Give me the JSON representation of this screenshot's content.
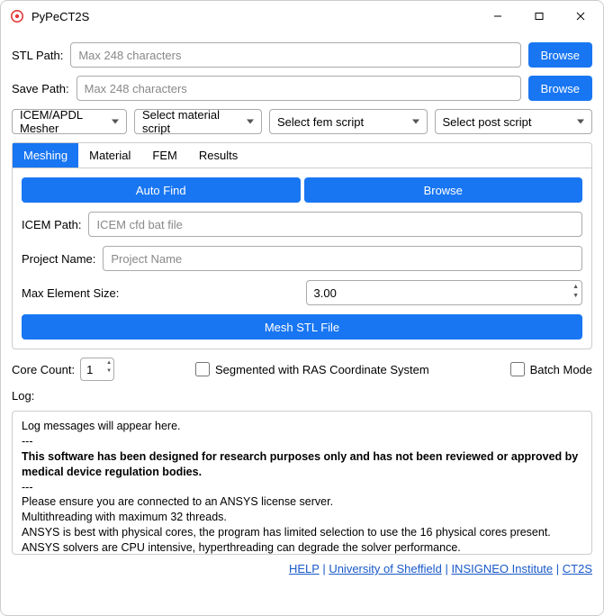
{
  "title": "PyPeCT2S",
  "stl": {
    "label": "STL Path:",
    "placeholder": "Max 248 characters",
    "browse": "Browse"
  },
  "save": {
    "label": "Save Path:",
    "placeholder": "Max 248 characters",
    "browse": "Browse"
  },
  "selects": {
    "mesher": "ICEM/APDL Mesher",
    "material": "Select material script",
    "fem": "Select fem script",
    "post": "Select post script"
  },
  "tabs": {
    "meshing": "Meshing",
    "material": "Material",
    "fem": "FEM",
    "results": "Results"
  },
  "meshing": {
    "auto_find": "Auto Find",
    "browse": "Browse",
    "icem_label": "ICEM Path:",
    "icem_placeholder": "ICEM cfd bat file",
    "project_label": "Project Name:",
    "project_placeholder": "Project Name",
    "maxel_label": "Max Element Size:",
    "maxel_value": "3.00",
    "mesh_btn": "Mesh STL File"
  },
  "core": {
    "label": "Core Count:",
    "value": "1"
  },
  "ras": "Segmented with RAS Coordinate System",
  "batch": "Batch Mode",
  "log_label": "Log:",
  "log": {
    "l1": "Log messages will appear here.",
    "sep": "---",
    "bold": "This software has been designed for research purposes only and has not been reviewed or approved by medical device regulation bodies.",
    "l2": "Please ensure you are connected to an ANSYS license server.",
    "l3": "Multithreading with maximum 32 threads.",
    "l4": "ANSYS is best with physical cores, the program has limited selection to use the 16 physical cores present.",
    "l5": "ANSYS solvers are CPU intensive, hyperthreading can degrade the solver performance."
  },
  "footer": {
    "help": "HELP",
    "uos": "University of Sheffield",
    "insigneo": "INSIGNEO Institute",
    "ct2s": "CT2S"
  }
}
